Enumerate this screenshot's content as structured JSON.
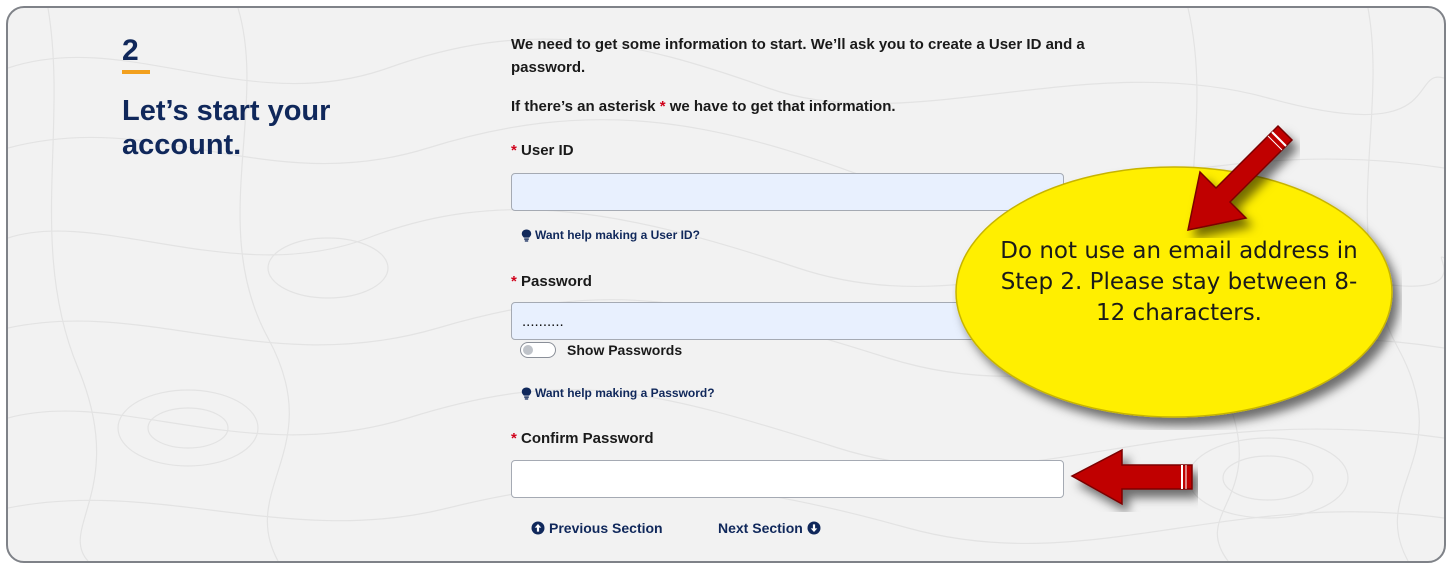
{
  "step": {
    "number": "2",
    "title": "Let’s start your account."
  },
  "intro": {
    "text": "We need to get some information to start. We’ll ask you to create a User ID and a password.",
    "asterisk_note_before": "If there’s an asterisk",
    "asterisk_symbol": "*",
    "asterisk_note_after": "we have to get that information."
  },
  "fields": {
    "user_id": {
      "required_mark": "*",
      "label": "User ID",
      "value": "",
      "help_link": "Want help making a User ID?"
    },
    "password": {
      "required_mark": "*",
      "label": "Password",
      "value": "..........",
      "help_link": "Want help making a Password?"
    },
    "show_passwords": {
      "label": "Show Passwords",
      "checked": false
    },
    "confirm_password": {
      "required_mark": "*",
      "label": "Confirm Password",
      "value": ""
    }
  },
  "navigation": {
    "previous": "Previous Section",
    "next": "Next Section"
  },
  "callout": {
    "text": "Do not use an email address in Step 2. Please stay between 8-12 characters."
  },
  "colors": {
    "brand_navy": "#10285b",
    "accent_orange": "#f2a01e",
    "required_red": "#d0021b",
    "callout_yellow": "#ffef00",
    "arrow_red": "#c00000"
  },
  "icons": {
    "help": "lightbulb-icon",
    "previous": "circle-arrow-up-icon",
    "next": "circle-arrow-down-icon"
  }
}
